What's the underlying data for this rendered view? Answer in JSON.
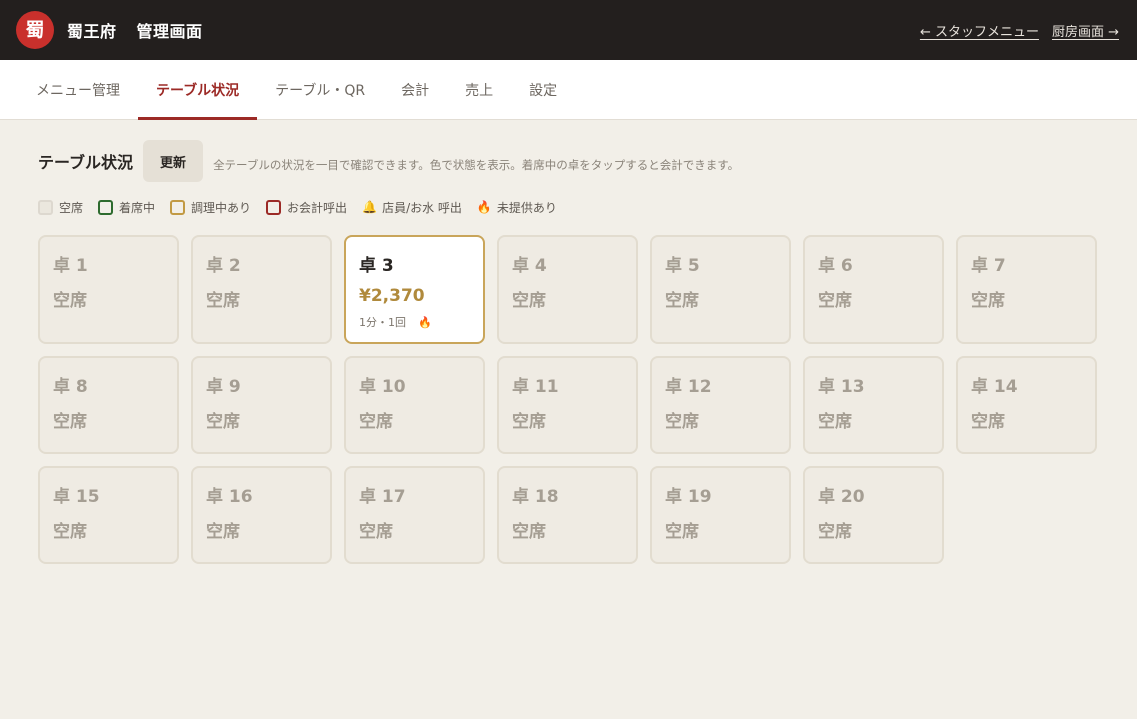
{
  "header": {
    "logo_glyph": "蜀",
    "brand": "蜀王府",
    "subtitle": "管理画面",
    "link_staff": "← スタッフメニュー",
    "link_kitchen": "厨房画面 →"
  },
  "tabs": [
    {
      "label": "メニュー管理"
    },
    {
      "label": "テーブル状況"
    },
    {
      "label": "テーブル・QR"
    },
    {
      "label": "会計"
    },
    {
      "label": "売上"
    },
    {
      "label": "設定"
    }
  ],
  "active_tab": "テーブル状況",
  "main": {
    "title": "テーブル状況",
    "refresh": "更新",
    "description": "全テーブルの状況を一目で確認できます。色で状態を表示。着席中の卓をタップすると会計できます。"
  },
  "legend": {
    "empty": "空席",
    "seated": "着席中",
    "cooking": "調理中あり",
    "bill": "お会計呼出",
    "staff_call": "店員/お水 呼出",
    "unserved": "未提供あり"
  },
  "colors": {
    "header_bg": "#231f1e",
    "accent": "#9c2a26",
    "cooking": "#c29a44",
    "seated": "#2e6b2e"
  },
  "tables": [
    {
      "name": "卓 1",
      "status": "空席"
    },
    {
      "name": "卓 2",
      "status": "空席"
    },
    {
      "name": "卓 3",
      "status": "¥2,370",
      "meta": "1分・1回",
      "icon": "fire-icon"
    },
    {
      "name": "卓 4",
      "status": "空席"
    },
    {
      "name": "卓 5",
      "status": "空席"
    },
    {
      "name": "卓 6",
      "status": "空席"
    },
    {
      "name": "卓 7",
      "status": "空席"
    },
    {
      "name": "卓 8",
      "status": "空席"
    },
    {
      "name": "卓 9",
      "status": "空席"
    },
    {
      "name": "卓 10",
      "status": "空席"
    },
    {
      "name": "卓 11",
      "status": "空席"
    },
    {
      "name": "卓 12",
      "status": "空席"
    },
    {
      "name": "卓 13",
      "status": "空席"
    },
    {
      "name": "卓 14",
      "status": "空席"
    },
    {
      "name": "卓 15",
      "status": "空席"
    },
    {
      "name": "卓 16",
      "status": "空席"
    },
    {
      "name": "卓 17",
      "status": "空席"
    },
    {
      "name": "卓 18",
      "status": "空席"
    },
    {
      "name": "卓 19",
      "status": "空席"
    },
    {
      "name": "卓 20",
      "status": "空席"
    }
  ]
}
